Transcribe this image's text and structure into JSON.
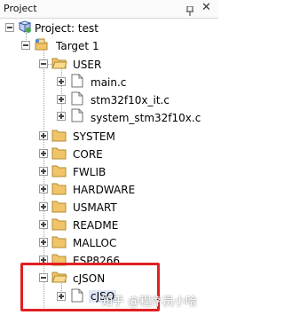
{
  "panel": {
    "title": "Project"
  },
  "tree": {
    "project": "Project: test",
    "target": "Target 1",
    "groups": [
      {
        "name": "USER",
        "expanded": true,
        "files": [
          "main.c",
          "stm32f10x_it.c",
          "system_stm32f10x.c"
        ]
      },
      {
        "name": "SYSTEM"
      },
      {
        "name": "CORE"
      },
      {
        "name": "FWLIB"
      },
      {
        "name": "HARDWARE"
      },
      {
        "name": "USMART"
      },
      {
        "name": "README"
      },
      {
        "name": "MALLOC"
      },
      {
        "name": "ESP8266"
      },
      {
        "name": "cJSON",
        "expanded": true,
        "files": [
          "cJSO"
        ]
      }
    ]
  },
  "watermark": "知乎 @程序员小哈",
  "colors": {
    "highlight": "#e02020",
    "folder": "#f2c46a",
    "tree_line": "#a0a0a0"
  },
  "icons": {
    "pin": "pin-icon",
    "close": "close-icon",
    "project": "project-icon",
    "target": "target-icon",
    "folder": "folder-icon",
    "file": "file-icon"
  }
}
